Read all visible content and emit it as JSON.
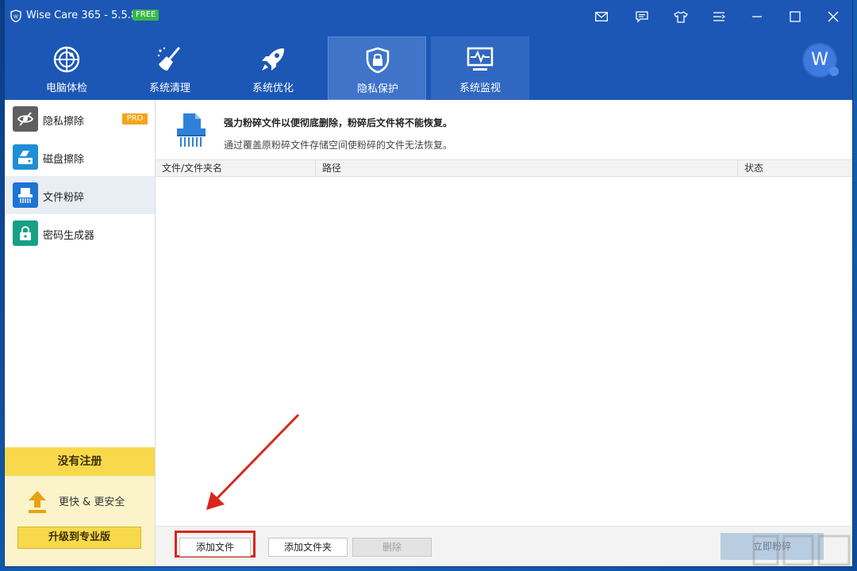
{
  "window": {
    "title": "Wise Care 365 - 5.5.8",
    "badge": "FREE"
  },
  "nav": {
    "items": [
      {
        "label": "电脑体检",
        "icon": "radar-icon"
      },
      {
        "label": "系统清理",
        "icon": "broom-icon"
      },
      {
        "label": "系统优化",
        "icon": "rocket-icon"
      },
      {
        "label": "隐私保护",
        "icon": "shield-lock-icon",
        "active": true
      },
      {
        "label": "系统监视",
        "icon": "monitor-pulse-icon"
      }
    ],
    "avatar_letter": "W"
  },
  "sidebar": {
    "items": [
      {
        "label": "隐私擦除",
        "badge": "PRO",
        "icon": "eye-off-icon",
        "color": "#5f5f5f"
      },
      {
        "label": "磁盘擦除",
        "icon": "disk-eraser-icon",
        "color": "#1e8fd6"
      },
      {
        "label": "文件粉碎",
        "icon": "shredder-icon",
        "color": "#1e73d6",
        "active": true
      },
      {
        "label": "密码生成器",
        "icon": "padlock-icon",
        "color": "#16a085"
      }
    ],
    "unregistered": {
      "title": "没有注册",
      "tagline": "更快 & 更安全",
      "upgrade_label": "升级到专业版"
    }
  },
  "main": {
    "header": {
      "title": "强力粉碎文件以便彻底删除，粉碎后文件将不能恢复。",
      "description": "通过覆盖原粉碎文件存储空间使粉碎的文件无法恢复。"
    },
    "table": {
      "columns": [
        "文件/文件夹名",
        "路径",
        "状态"
      ],
      "rows": []
    },
    "buttons": {
      "add_file": "添加文件",
      "add_folder": "添加文件夹",
      "delete": "删除",
      "shred_now": "立即粉碎"
    }
  },
  "colors": {
    "titlebar": "#1c57b6",
    "nav_active": "#3f74c9",
    "highlight": "#d9261c",
    "unreg_yellow": "#f8d94c"
  }
}
